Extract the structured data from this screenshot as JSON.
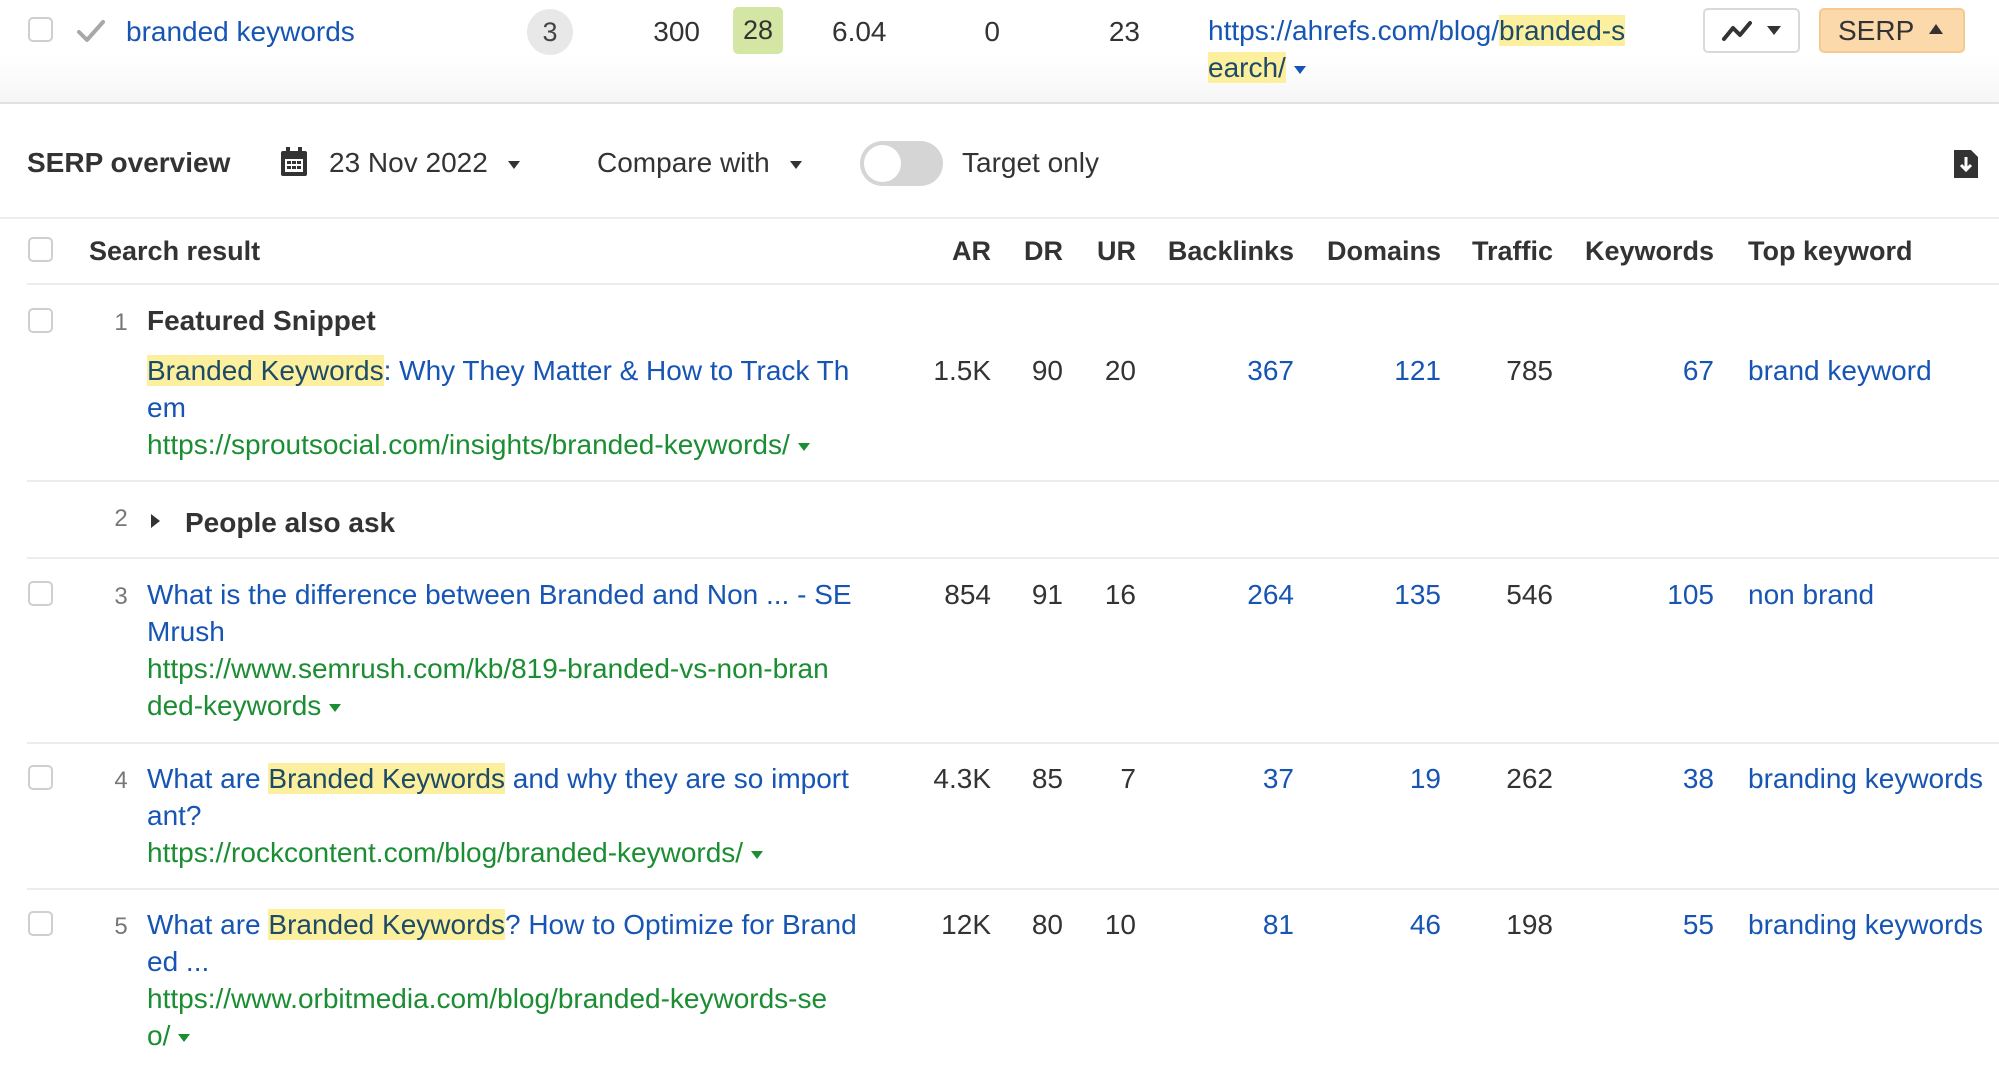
{
  "keyword_row": {
    "keyword": "branded keywords",
    "serp_features_count": "3",
    "volume": "300",
    "kd": "28",
    "cpc": "6.04",
    "clicks": "0",
    "traffic_potential": "23",
    "url_prefix": "https://ahrefs.com/blog/",
    "url_highlight_line1": "branded-s",
    "url_highlight_line2": "earch/",
    "chart_button_icon": "trend-line-icon",
    "serp_button_label": "SERP",
    "colors": {
      "kd_badge": "#d3e6a4",
      "serp_button": "#fcd9ab",
      "link": "#1755b4"
    }
  },
  "toolbar": {
    "title": "SERP overview",
    "date": "23 Nov 2022",
    "compare_with": "Compare with",
    "target_only_label": "Target only",
    "target_only_enabled": false
  },
  "table": {
    "columns": [
      "Search result",
      "AR",
      "DR",
      "UR",
      "Backlinks",
      "Domains",
      "Traffic",
      "Keywords",
      "Top keyword"
    ],
    "rows": [
      {
        "rank": "1",
        "label": "Featured Snippet",
        "title_hl": "Branded Keywords",
        "title_rest_1": ": Why They Matter & How to Track Th",
        "title_line2": "em",
        "url": "https://sproutsocial.com/insights/branded-keywords/",
        "ar": "1.5K",
        "dr": "90",
        "ur": "20",
        "backlinks": "367",
        "domains": "121",
        "traffic": "785",
        "keywords": "67",
        "top_keyword": "brand keyword"
      },
      {
        "rank": "2",
        "label": "People also ask"
      },
      {
        "rank": "3",
        "title_line1": "What is the difference between Branded and Non ... - SE",
        "title_line2": "Mrush",
        "url_line1": "https://www.semrush.com/kb/819-branded-vs-non-bran",
        "url_line2": "ded-keywords",
        "ar": "854",
        "dr": "91",
        "ur": "16",
        "backlinks": "264",
        "domains": "135",
        "traffic": "546",
        "keywords": "105",
        "top_keyword": "non brand"
      },
      {
        "rank": "4",
        "title_pre": "What are ",
        "title_hl": "Branded Keywords",
        "title_post": " and why they are so import",
        "title_line2": "ant?",
        "url": "https://rockcontent.com/blog/branded-keywords/",
        "ar": "4.3K",
        "dr": "85",
        "ur": "7",
        "backlinks": "37",
        "domains": "19",
        "traffic": "262",
        "keywords": "38",
        "top_keyword": "branding keywords"
      },
      {
        "rank": "5",
        "title_pre": "What are ",
        "title_hl": "Branded Keywords",
        "title_post": "? How to Optimize for Brand",
        "title_line2": "ed ...",
        "url_line1": "https://www.orbitmedia.com/blog/branded-keywords-se",
        "url_line2": "o/",
        "ar": "12K",
        "dr": "80",
        "ur": "10",
        "backlinks": "81",
        "domains": "46",
        "traffic": "198",
        "keywords": "55",
        "top_keyword": "branding keywords"
      }
    ]
  }
}
